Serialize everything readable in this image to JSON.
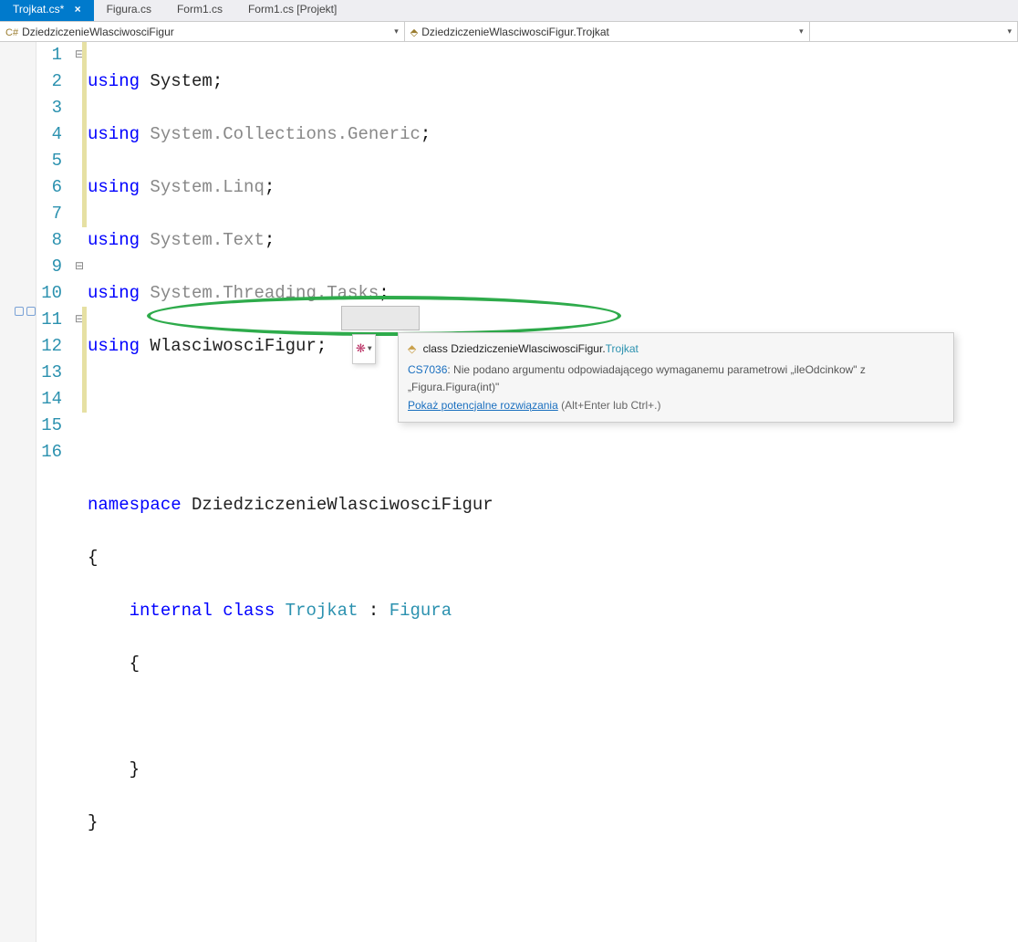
{
  "tabs": {
    "active": {
      "label": "Trojkat.cs*",
      "close": "×"
    },
    "others": [
      "Figura.cs",
      "Form1.cs",
      "Form1.cs [Projekt]"
    ]
  },
  "nav": {
    "left": "DziedziczenieWlasciwosciFigur",
    "right": "DziedziczenieWlasciwosciFigur.Trojkat"
  },
  "lines": {
    "l1": "1",
    "l2": "2",
    "l3": "3",
    "l4": "4",
    "l5": "5",
    "l6": "6",
    "l7": "7",
    "l8": "8",
    "l9": "9",
    "l10": "10",
    "l11": "11",
    "l12": "12",
    "l13": "13",
    "l14": "14",
    "l15": "15",
    "l16": "16"
  },
  "code": {
    "kw_using": "using",
    "kw_namespace": "namespace",
    "kw_internal": "internal",
    "kw_class": "class",
    "ns_system": "System",
    "ns_coll": "System.Collections.Generic",
    "ns_linq": "System.Linq",
    "ns_text": "System.Text",
    "ns_tasks": "System.Threading.Tasks",
    "ns_wf": "WlasciwosciFigur",
    "ns_name": "DziedziczenieWlasciwosciFigur",
    "cls_troj": "Trojkat",
    "cls_fig": "Figura",
    "semi": ";",
    "colon": " : ",
    "brace_o": "{",
    "brace_c": "}"
  },
  "tooltip": {
    "icon_label": "class",
    "ns": "DziedziczenieWlasciwosciFigur.",
    "type": "Trojkat",
    "errcode": "CS7036",
    "errmsg": ": Nie podano argumentu odpowiadającego wymaganemu parametrowi „ileOdcinkow\" z „Figura.Figura(int)\"",
    "link": "Pokaż potencjalne rozwiązania",
    "hint": " (Alt+Enter lub Ctrl+.)"
  }
}
